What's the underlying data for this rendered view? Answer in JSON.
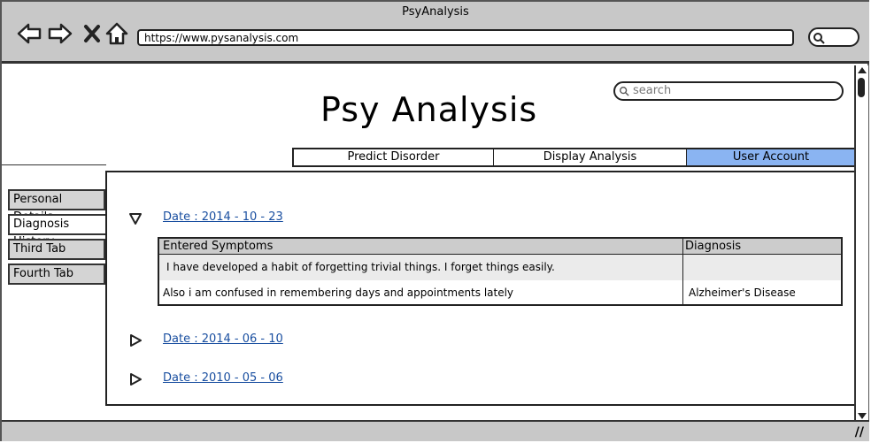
{
  "window": {
    "title": "PsyAnalysis"
  },
  "browser": {
    "url": "https://www.pysanalysis.com"
  },
  "app": {
    "title": "Psy Analysis",
    "search_placeholder": "search"
  },
  "top_tabs": [
    {
      "label": "Predict Disorder",
      "active": false
    },
    {
      "label": "Display Analysis",
      "active": false
    },
    {
      "label": "User Account",
      "active": true
    }
  ],
  "side_tabs": [
    {
      "label": "Personal Details",
      "active": false
    },
    {
      "label": "Diagnosis History",
      "active": true
    },
    {
      "label": "Third Tab",
      "active": false
    },
    {
      "label": "Fourth Tab",
      "active": false
    }
  ],
  "history": [
    {
      "date": "Date : 2014 - 10 - 23",
      "expanded": true,
      "table": {
        "headers": [
          "Entered Symptoms",
          "Diagnosis"
        ],
        "rows": [
          {
            "symptom": "I have developed a habit of forgetting trivial things. I forget things easily.",
            "diagnosis": ""
          },
          {
            "symptom": "Also i am confused in remembering days and appointments lately",
            "diagnosis": "Alzheimer's Disease"
          }
        ]
      }
    },
    {
      "date": "Date : 2014 - 06 - 10",
      "expanded": false
    },
    {
      "date": "Date : 2010 - 05 - 06",
      "expanded": false
    }
  ],
  "colors": {
    "chrome": "#c8c8c8",
    "active_tab": "#8ab4f2",
    "link": "#1a4fa0"
  }
}
